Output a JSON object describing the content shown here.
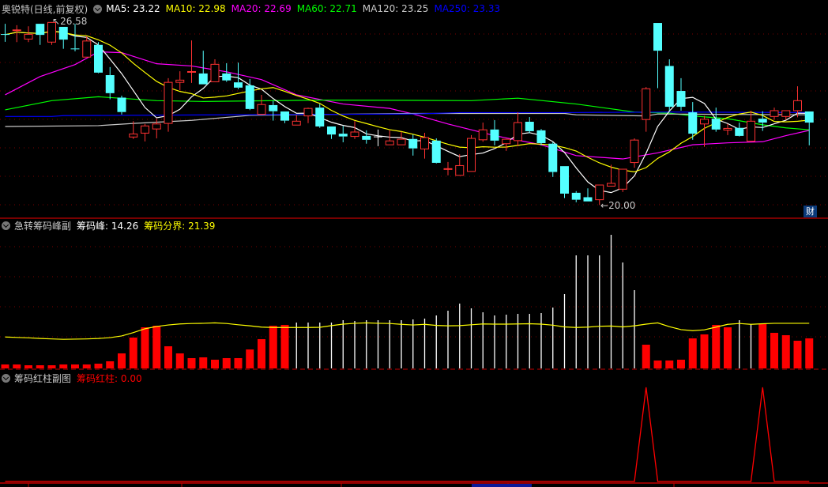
{
  "header": {
    "title": "奥锐特(日线,前复权)",
    "ma": [
      {
        "label": "MA5: 23.22",
        "color": "#ffffff"
      },
      {
        "label": "MA10: 22.98",
        "color": "#ffff00"
      },
      {
        "label": "MA20: 22.69",
        "color": "#ff00ff"
      },
      {
        "label": "MA60: 22.71",
        "color": "#00ff00"
      },
      {
        "label": "MA120: 23.25",
        "color": "#c8c8c8"
      },
      {
        "label": "MA250: 23.33",
        "color": "#0000ff"
      }
    ]
  },
  "panel2": {
    "title": "急转筹码峰副",
    "peak_label": "筹码峰: 14.26",
    "boundary_label": "筹码分界: 21.39"
  },
  "panel3": {
    "title": "筹码红柱副图",
    "value_label": "筹码红柱: 0.00"
  },
  "cai_button": "财",
  "colors": {
    "up": "#ff3232",
    "down": "#54ffff",
    "grid": "#7a0000",
    "border": "#c00000"
  },
  "chart_data": [
    {
      "type": "candlestick",
      "title": "奥锐特 日线 前复权",
      "ylim": [
        20.0,
        26.58
      ],
      "high_label": "26.58",
      "low_label": "20.00",
      "high_index": 4,
      "low_index": 51,
      "candles_ohlc": [
        [
          26.16,
          26.53,
          25.88,
          26.14
        ],
        [
          26.29,
          26.48,
          25.87,
          26.31
        ],
        [
          25.98,
          26.44,
          25.87,
          26.15
        ],
        [
          26.53,
          26.53,
          25.77,
          26.13
        ],
        [
          25.87,
          26.58,
          25.77,
          26.58
        ],
        [
          26.42,
          26.42,
          25.63,
          25.96
        ],
        [
          25.64,
          26.53,
          25.54,
          25.62
        ],
        [
          25.33,
          26.08,
          25.33,
          25.91
        ],
        [
          25.77,
          25.87,
          24.75,
          24.77
        ],
        [
          24.68,
          24.97,
          23.81,
          24.03
        ],
        [
          23.87,
          23.94,
          23.26,
          23.35
        ],
        [
          22.45,
          23.02,
          22.38,
          22.56
        ],
        [
          22.59,
          22.92,
          22.29,
          22.85
        ],
        [
          22.74,
          23.11,
          22.4,
          22.92
        ],
        [
          22.94,
          24.57,
          22.64,
          24.42
        ],
        [
          24.42,
          24.82,
          24.14,
          24.5
        ],
        [
          24.79,
          25.93,
          24.4,
          24.81
        ],
        [
          24.74,
          25.56,
          24.35,
          24.35
        ],
        [
          24.44,
          25.25,
          24.44,
          25.07
        ],
        [
          24.74,
          25.11,
          24.44,
          24.49
        ],
        [
          24.42,
          25.13,
          24.18,
          24.23
        ],
        [
          24.31,
          24.54,
          23.42,
          23.46
        ],
        [
          23.27,
          23.97,
          23.27,
          23.62
        ],
        [
          23.6,
          23.76,
          23.04,
          23.38
        ],
        [
          23.37,
          23.37,
          22.95,
          23.04
        ],
        [
          22.88,
          23.23,
          22.88,
          23.02
        ],
        [
          23.21,
          23.51,
          22.95,
          23.48
        ],
        [
          23.51,
          23.64,
          22.78,
          22.83
        ],
        [
          22.83,
          22.83,
          22.38,
          22.54
        ],
        [
          22.57,
          22.85,
          22.26,
          22.47
        ],
        [
          22.47,
          23.02,
          22.38,
          22.63
        ],
        [
          22.49,
          22.69,
          22.21,
          22.35
        ],
        [
          22.47,
          22.72,
          22.12,
          22.47
        ],
        [
          22.17,
          22.69,
          22.17,
          22.31
        ],
        [
          22.17,
          22.64,
          22.17,
          22.37
        ],
        [
          22.38,
          22.54,
          21.78,
          22.04
        ],
        [
          22.02,
          22.6,
          21.67,
          22.43
        ],
        [
          22.32,
          22.4,
          21.5,
          21.52
        ],
        [
          21.29,
          21.55,
          21.07,
          21.31
        ],
        [
          21.07,
          21.83,
          21.07,
          21.42
        ],
        [
          21.21,
          22.52,
          21.21,
          22.4
        ],
        [
          22.35,
          22.97,
          22.28,
          22.71
        ],
        [
          22.72,
          23.06,
          22.15,
          22.32
        ],
        [
          22.21,
          22.39,
          21.95,
          22.37
        ],
        [
          22.32,
          23.34,
          22.12,
          22.97
        ],
        [
          23.0,
          23.17,
          22.59,
          22.66
        ],
        [
          22.69,
          22.74,
          22.15,
          22.23
        ],
        [
          22.21,
          22.26,
          21.01,
          21.19
        ],
        [
          21.4,
          21.4,
          20.25,
          20.41
        ],
        [
          20.44,
          20.5,
          20.1,
          20.19
        ],
        [
          20.28,
          20.6,
          20.13,
          20.13
        ],
        [
          20.19,
          20.72,
          20.0,
          20.72
        ],
        [
          20.68,
          21.45,
          20.68,
          20.78
        ],
        [
          20.57,
          21.29,
          20.47,
          21.29
        ],
        [
          21.53,
          22.4,
          21.34,
          22.34
        ],
        [
          23.08,
          24.25,
          22.64,
          24.19
        ],
        [
          26.56,
          26.56,
          24.21,
          25.56
        ],
        [
          25.01,
          25.25,
          23.4,
          23.54
        ],
        [
          24.11,
          24.57,
          23.4,
          23.54
        ],
        [
          23.34,
          23.71,
          22.35,
          22.57
        ],
        [
          22.92,
          23.21,
          22.1,
          23.09
        ],
        [
          23.11,
          23.51,
          22.64,
          22.72
        ],
        [
          22.7,
          22.92,
          22.52,
          22.76
        ],
        [
          22.78,
          22.97,
          22.47,
          22.49
        ],
        [
          22.3,
          23.4,
          22.3,
          23.02
        ],
        [
          23.11,
          23.38,
          22.67,
          22.97
        ],
        [
          23.19,
          23.51,
          23.07,
          23.4
        ],
        [
          23.19,
          23.4,
          23.07,
          23.4
        ],
        [
          23.4,
          24.28,
          23.16,
          23.76
        ],
        [
          23.37,
          23.37,
          22.15,
          22.97
        ]
      ],
      "ma_computed": [
        {
          "name": "MA5",
          "period": 5,
          "color": "#ffffff"
        },
        {
          "name": "MA10",
          "period": 10,
          "color": "#ffff00"
        }
      ],
      "ma_sampled": [
        {
          "name": "MA20",
          "color": "#ff00ff",
          "points": [
            [
              0,
              23.97
            ],
            [
              3,
              24.63
            ],
            [
              6,
              25.06
            ],
            [
              8,
              25.52
            ],
            [
              10,
              25.49
            ],
            [
              13,
              25.09
            ],
            [
              16,
              25.01
            ],
            [
              19,
              24.8
            ],
            [
              22,
              24.52
            ],
            [
              25,
              23.97
            ],
            [
              29,
              23.64
            ],
            [
              33,
              23.48
            ],
            [
              35,
              23.28
            ],
            [
              38,
              22.92
            ],
            [
              42,
              22.5
            ],
            [
              46,
              22.17
            ],
            [
              49,
              21.78
            ],
            [
              53,
              21.66
            ],
            [
              56,
              21.88
            ],
            [
              59,
              22.17
            ],
            [
              62,
              22.24
            ],
            [
              65,
              22.28
            ],
            [
              67,
              22.5
            ],
            [
              69,
              22.69
            ]
          ]
        },
        {
          "name": "MA60",
          "color": "#00ff00",
          "points": [
            [
              0,
              23.43
            ],
            [
              4,
              23.76
            ],
            [
              8,
              23.9
            ],
            [
              13,
              23.76
            ],
            [
              17,
              23.73
            ],
            [
              27,
              23.78
            ],
            [
              36,
              23.77
            ],
            [
              40,
              23.76
            ],
            [
              44,
              23.85
            ],
            [
              49,
              23.64
            ],
            [
              54,
              23.35
            ],
            [
              57,
              23.31
            ],
            [
              59,
              23.21
            ],
            [
              62,
              23.11
            ],
            [
              65,
              22.89
            ],
            [
              67,
              22.78
            ],
            [
              69,
              22.71
            ]
          ]
        },
        {
          "name": "MA120",
          "color": "#c8c8c8",
          "points": [
            [
              0,
              22.83
            ],
            [
              8,
              22.86
            ],
            [
              11,
              22.94
            ],
            [
              16,
              23.05
            ],
            [
              21,
              23.23
            ],
            [
              35,
              23.3
            ],
            [
              48,
              23.3
            ],
            [
              49,
              23.25
            ],
            [
              55,
              23.21
            ],
            [
              56,
              23.28
            ],
            [
              69,
              23.25
            ]
          ]
        },
        {
          "name": "MA250",
          "color": "#0000ff",
          "points": [
            [
              0,
              23.19
            ],
            [
              4,
              23.19
            ],
            [
              5,
              23.22
            ],
            [
              19,
              23.25
            ],
            [
              35,
              23.28
            ],
            [
              39,
              23.33
            ],
            [
              48,
              23.33
            ],
            [
              57,
              23.35
            ],
            [
              69,
              23.33
            ]
          ]
        }
      ]
    },
    {
      "type": "bar",
      "title": "急转筹码峰副",
      "series": [
        {
          "name": "筹码峰",
          "values": [
            1.88,
            1.88,
            1.5,
            1.5,
            1.5,
            1.88,
            1.88,
            1.88,
            2.25,
            3.38,
            7.13,
            14.63,
            19.5,
            20.25,
            10.5,
            7.13,
            4.88,
            5.25,
            4.13,
            4.88,
            4.88,
            9,
            13.88,
            20.25,
            20.63,
            21.75,
            21.75,
            21.75,
            21.75,
            22.88,
            22.5,
            22.88,
            22.88,
            22.88,
            22.88,
            23.25,
            23.63,
            25.13,
            27.38,
            30.75,
            28.5,
            26.63,
            25.13,
            25.5,
            25.88,
            25.88,
            26.25,
            28.88,
            35.25,
            53.63,
            53.63,
            53.63,
            63.38,
            50.25,
            37.13,
            11.25,
            3.75,
            3.75,
            4.13,
            14.25,
            16.13,
            20.63,
            19.5,
            22.88,
            21,
            21,
            16.88,
            15.75,
            13.13,
            14.26
          ],
          "colors": [
            "r",
            "r",
            "r",
            "r",
            "r",
            "r",
            "r",
            "r",
            "r",
            "r",
            "r",
            "r",
            "r",
            "r",
            "r",
            "r",
            "r",
            "r",
            "r",
            "r",
            "r",
            "r",
            "r",
            "r",
            "r",
            "w",
            "w",
            "w",
            "w",
            "w",
            "w",
            "w",
            "w",
            "w",
            "w",
            "w",
            "w",
            "w",
            "w",
            "w",
            "w",
            "w",
            "w",
            "w",
            "w",
            "w",
            "w",
            "w",
            "w",
            "w",
            "w",
            "w",
            "w",
            "w",
            "w",
            "r",
            "r",
            "r",
            "r",
            "r",
            "r",
            "r",
            "r",
            "w",
            "w",
            "r",
            "r",
            "r",
            "r",
            "r"
          ]
        },
        {
          "name": "筹码分界",
          "type": "line",
          "values": [
            14.9,
            14.7,
            14.5,
            14.2,
            14.0,
            13.8,
            13.9,
            14.0,
            14.2,
            14.6,
            15.4,
            17.0,
            18.8,
            19.9,
            20.6,
            21.1,
            21.3,
            21.4,
            21.6,
            21.3,
            20.7,
            20.2,
            19.6,
            19.4,
            19.4,
            19.4,
            19.4,
            19.5,
            20.3,
            21.0,
            21.4,
            21.6,
            21.4,
            21.3,
            20.9,
            20.6,
            20.9,
            20.4,
            20.2,
            20.3,
            20.7,
            21.1,
            21.0,
            21.0,
            21.1,
            21.2,
            21.0,
            20.5,
            19.7,
            19.4,
            19.6,
            20.0,
            20.1,
            19.7,
            20.2,
            21.0,
            21.6,
            19.8,
            18.4,
            17.9,
            18.3,
            19.6,
            20.9,
            21.3,
            20.9,
            21.2,
            21.4,
            21.4,
            21.4,
            21.39
          ]
        }
      ],
      "ylim": [
        0,
        70
      ]
    },
    {
      "type": "line",
      "title": "筹码红柱副图",
      "series": [
        {
          "name": "筹码红柱",
          "color": "#ff0000",
          "values": [
            0,
            0,
            0,
            0,
            0,
            0,
            0,
            0,
            0,
            0,
            0,
            0,
            0,
            0,
            0,
            0,
            0,
            0,
            0,
            0,
            0,
            0,
            0,
            0,
            0,
            0,
            0,
            0,
            0,
            0,
            0,
            0,
            0,
            0,
            0,
            0,
            0,
            0,
            0,
            0,
            0,
            0,
            0,
            0,
            0,
            0,
            0,
            0,
            0,
            0,
            0,
            0,
            0,
            0,
            0,
            1,
            0,
            0,
            0,
            0,
            0,
            0,
            0,
            0,
            0,
            1,
            0,
            0,
            0,
            0
          ]
        }
      ],
      "ylim": [
        0,
        1
      ]
    }
  ]
}
